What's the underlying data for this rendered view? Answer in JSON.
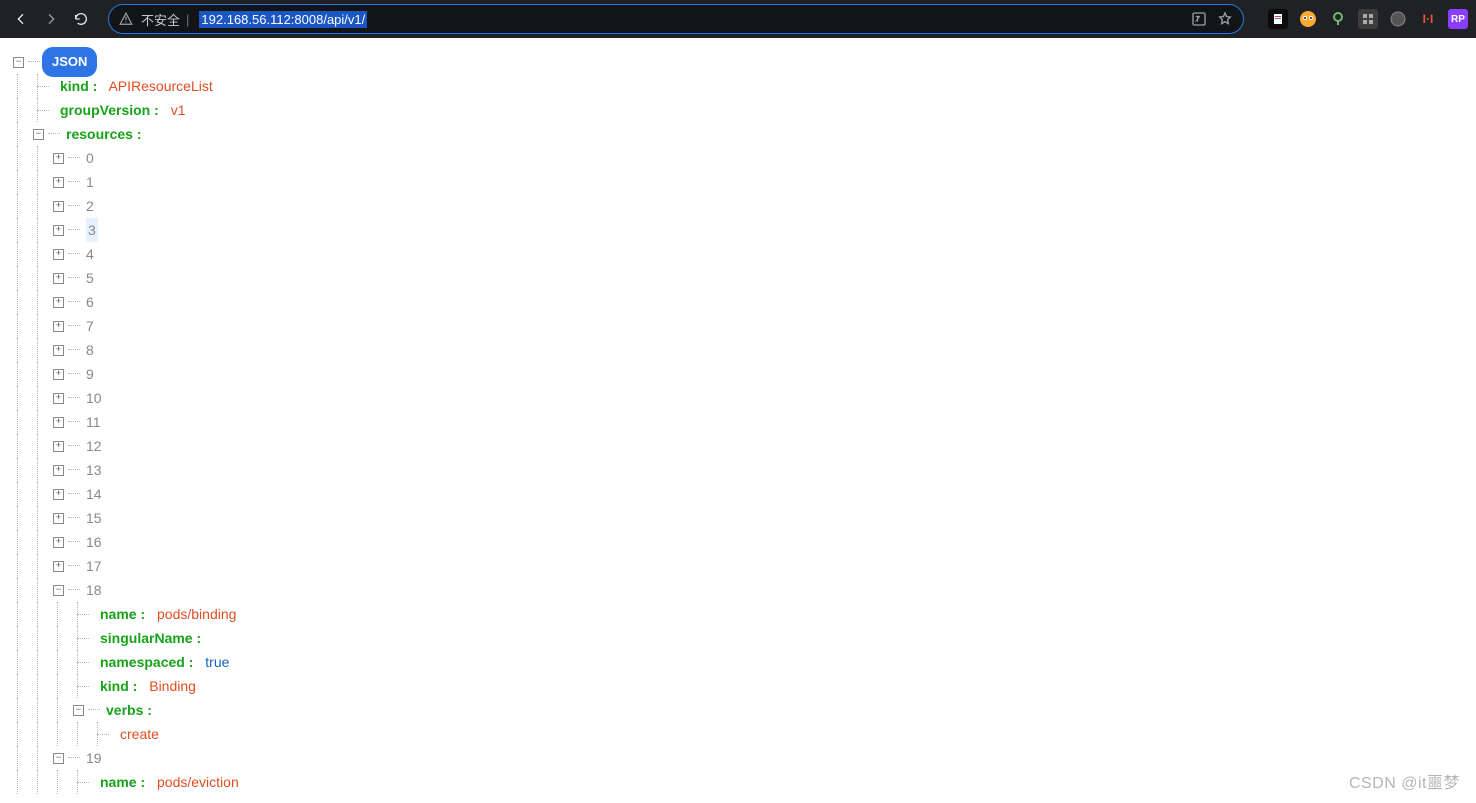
{
  "browser": {
    "insecure_label": "不安全",
    "url_selected": "192.168.56.112:8008/api/v1/",
    "extensions": [
      {
        "bg": "#0b0b0b",
        "txt": "",
        "svg": "note"
      },
      {
        "bg": "#ff9030",
        "txt": "",
        "svg": "owl"
      },
      {
        "bg": "transparent",
        "txt": "",
        "svg": "pin"
      },
      {
        "bg": "#3d3d3d",
        "txt": "",
        "svg": "grid"
      },
      {
        "bg": "transparent",
        "txt": "",
        "svg": "globe"
      },
      {
        "bg": "transparent",
        "txt": "",
        "svg": "red-h"
      },
      {
        "bg": "#8a3dff",
        "txt": "RP",
        "svg": ""
      }
    ]
  },
  "tree": {
    "root_badge": "JSON",
    "kind_key": "kind :",
    "kind_val": "APIResourceList",
    "gv_key": "groupVersion :",
    "gv_val": "v1",
    "res_key": "resources :",
    "indices": [
      "0",
      "1",
      "2",
      "3",
      "4",
      "5",
      "6",
      "7",
      "8",
      "9",
      "10",
      "11",
      "12",
      "13",
      "14",
      "15",
      "16",
      "17",
      "18",
      "19"
    ],
    "item18": {
      "idx": "18",
      "name_key": "name :",
      "name_val": "pods/binding",
      "sn_key": "singularName :",
      "ns_key": "namespaced :",
      "ns_val": "true",
      "kind_key": "kind :",
      "kind_val": "Binding",
      "verbs_key": "verbs :",
      "verb0": "create"
    },
    "item19": {
      "idx": "19",
      "name_key": "name :",
      "name_val": "pods/eviction"
    }
  },
  "watermark": "CSDN @it噩梦"
}
